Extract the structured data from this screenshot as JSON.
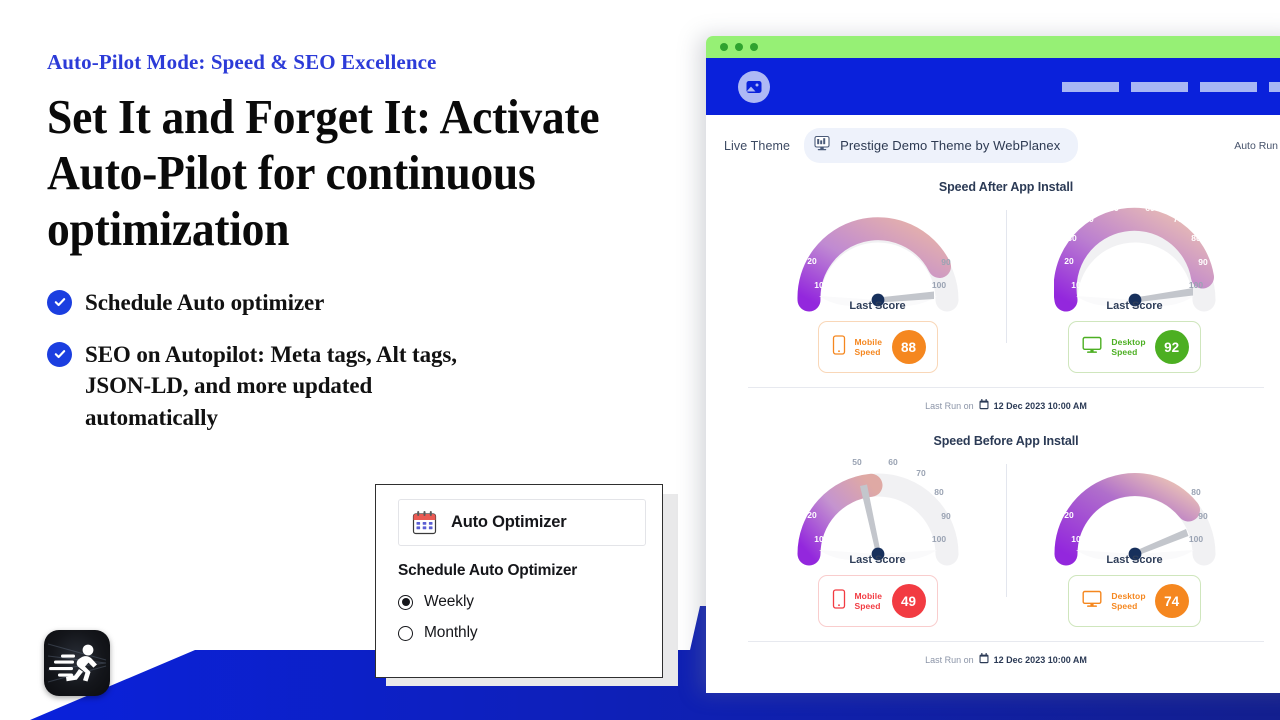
{
  "slide": {
    "eyebrow": "Auto-Pilot Mode: Speed & SEO Excellence",
    "headline": "Set It and Forget It: Activate Auto-Pilot for continuous optimization",
    "bullets": [
      {
        "icon": "check-circle-icon",
        "text": "Schedule Auto optimizer"
      },
      {
        "icon": "check-circle-icon",
        "text": "SEO on Autopilot: Meta tags, Alt tags, JSON-LD, and more updated automatically"
      }
    ],
    "logo": {
      "icon": "running-man-logo-icon"
    },
    "colors": {
      "eyebrow_blue": "#2c3bd8",
      "check_blue": "#1b3ee0",
      "band_blue": "#0a21db",
      "headline_black": "#0a0a0a"
    }
  },
  "optimizer_popup": {
    "header": {
      "icon": "calendar-icon",
      "label": "Auto Optimizer"
    },
    "section_title": "Schedule Auto Optimizer",
    "options": [
      {
        "label": "Weekly",
        "selected": true
      },
      {
        "label": "Monthly",
        "selected": false
      }
    ]
  },
  "browser": {
    "titlebar": {
      "dots": 3,
      "color": "#96f075"
    },
    "navbar": {
      "color": "#0a21db",
      "logo_icon": "image-placeholder-logo-icon",
      "placeholder_items": 4
    },
    "theme_row": {
      "label": "Live Theme",
      "pill_icon": "monitor-theme-icon",
      "pill_name": "Prestige Demo Theme by WebPlanex",
      "auto_run_label": "Auto Run",
      "auto_run_color": "#34b233"
    },
    "sections": [
      {
        "title": "Speed After App Install",
        "gauges": [
          {
            "caption": "Last Score",
            "score": 88,
            "device_icon": "mobile-phone-icon",
            "device_label_line1": "Mobile",
            "device_label_line2": "Speed",
            "badge_color": "#f5871f",
            "card_border": "#f9d7b8",
            "text_color": "#f5871f"
          },
          {
            "caption": "Last Score",
            "score": 92,
            "device_icon": "desktop-monitor-icon",
            "device_label_line1": "Desktop",
            "device_label_line2": "Speed",
            "badge_color": "#4caf22",
            "card_border": "#cfe6bd",
            "text_color": "#4caf22"
          }
        ],
        "last_run_prefix": "Last Run on",
        "last_run_icon": "calendar-small-icon",
        "last_run_date": "12 Dec 2023 10:00 AM"
      },
      {
        "title": "Speed Before App Install",
        "gauges": [
          {
            "caption": "Last Score",
            "score": 49,
            "device_icon": "mobile-phone-icon",
            "device_label_line1": "Mobile",
            "device_label_line2": "Speed",
            "badge_color": "#f23b42",
            "card_border": "#f9cdcd",
            "text_color": "#f23b42"
          },
          {
            "caption": "Last Score",
            "score": 74,
            "device_icon": "desktop-monitor-icon",
            "device_label_line1": "Desktop",
            "device_label_line2": "Speed",
            "badge_color": "#f5871f",
            "card_border": "#cfe6bd",
            "text_color": "#f5871f"
          }
        ],
        "last_run_prefix": "Last Run on",
        "last_run_icon": "calendar-small-icon",
        "last_run_date": "12 Dec 2023 10:00 AM"
      }
    ],
    "gauge_ticks": [
      "10",
      "20",
      "30",
      "40",
      "50",
      "60",
      "70",
      "80",
      "90",
      "100"
    ]
  }
}
